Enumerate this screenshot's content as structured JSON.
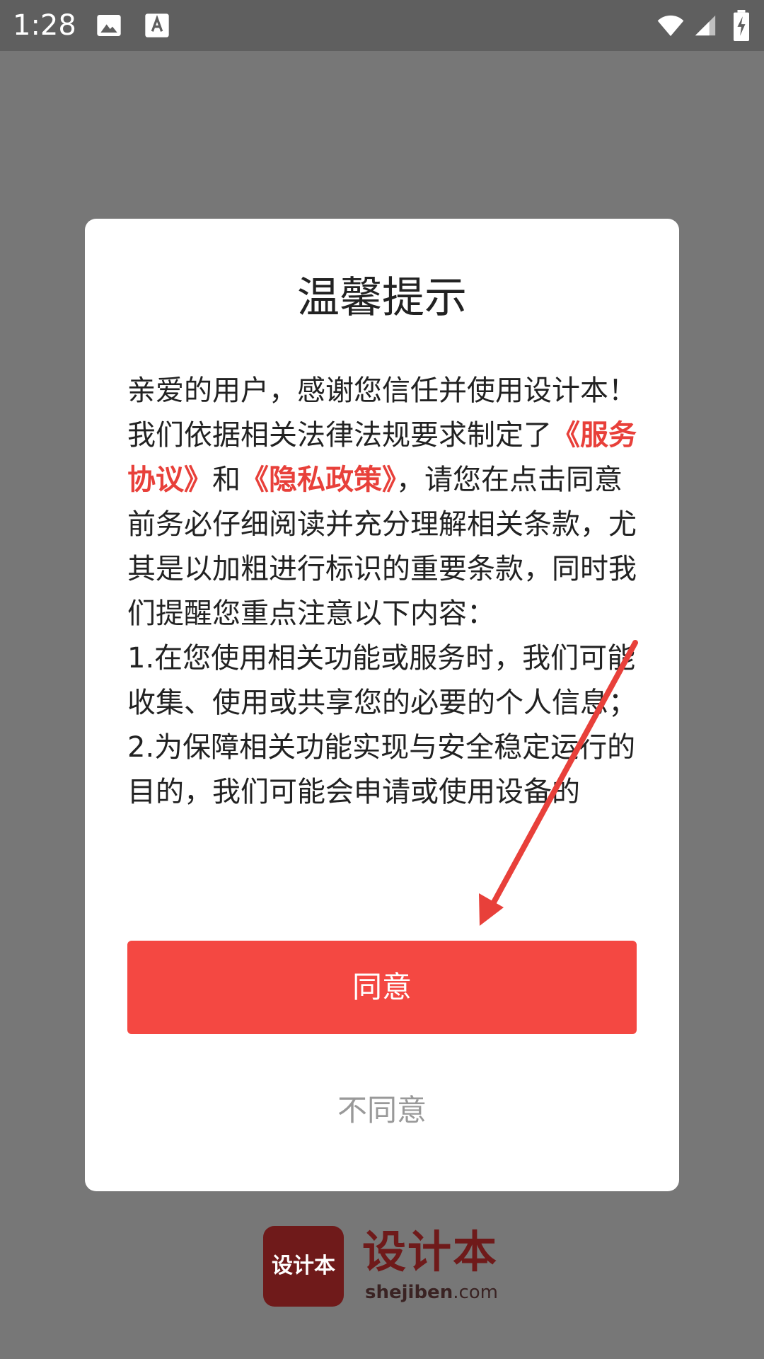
{
  "status_bar": {
    "time": "1:28",
    "left_icons": [
      "image-icon",
      "keyboard-a-icon"
    ],
    "right_icons": [
      "wifi-icon",
      "signal-icon",
      "battery-charging-icon"
    ]
  },
  "dialog": {
    "title": "温馨提示",
    "body": {
      "p1_before": "亲爱的用户，感谢您信任并使用设计本！我们依据相关法律法规要求制定了",
      "service_link": "《服务协议》",
      "and_text": "和",
      "privacy_link": "《隐私政策》",
      "p1_after": "，请您在点击同意前务必仔细阅读并充分理解相关条款，尤其是以加粗进行标识的重要条款，同时我们提醒您重点注意以下内容：",
      "item1": "1.在您使用相关功能或服务时，我们可能收集、使用或共享您的必要的个人信息；",
      "item2": "2.为保障相关功能实现与安全稳定运行的目的，我们可能会申请或使用设备的"
    },
    "agree_label": "同意",
    "disagree_label": "不同意"
  },
  "watermark": {
    "badge_text": "设计本",
    "brand_name": "设计本",
    "domain_bold": "shejiben",
    "domain_rest": ".com"
  },
  "colors": {
    "accent_red": "#f44842",
    "link_red": "#e8403a",
    "overlay_gray": "#777777",
    "annotation_arrow": "#e8403a"
  }
}
